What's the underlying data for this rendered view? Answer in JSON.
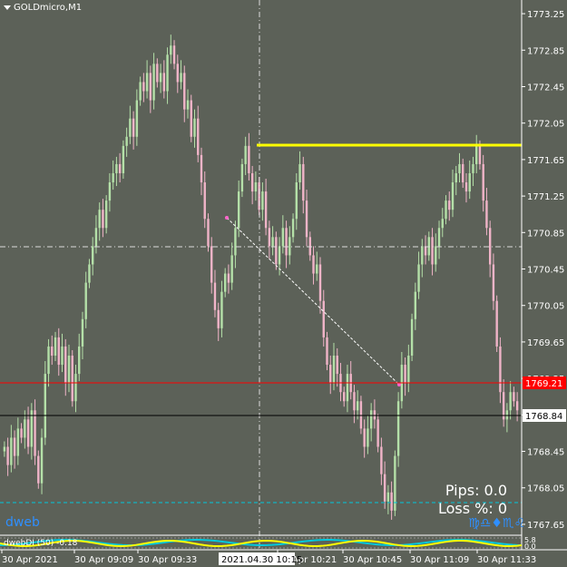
{
  "chart": {
    "symbol_label": "GOLDmicro,M1",
    "brand": "dweb",
    "pips_text": "Pips: 0.0",
    "loss_text": "Loss %: 0",
    "zodiac_text": "♍♎♦♏♌",
    "indicator_label": "dwebDI (50) -0.18",
    "price_labels": [
      "1773.25",
      "1772.85",
      "1772.45",
      "1772.05",
      "1771.65",
      "1771.25",
      "1770.85",
      "1770.45",
      "1770.05",
      "1769.65",
      "1769.25",
      "1768.85",
      "1768.45",
      "1768.05",
      "1767.65"
    ],
    "time_labels": [
      "30 Apr 2021",
      "30 Apr 09:09",
      "30 Apr 09:33",
      "30 Apr 10:21",
      "30 Apr 10:45",
      "30 Apr 11:09",
      "30 Apr 11:33"
    ],
    "cursor_time_label": "2021.04.30 10:15",
    "bid_price_label": "1769.21",
    "price_tag_label": "1768.84",
    "ind_scale_top": "5.8",
    "ind_scale_bottom": "0.0",
    "colors": {
      "background": "#5c6158",
      "bull": "#b4e0a8",
      "bear": "#f0b4c8",
      "resistance": "#ffff00",
      "bid": "#ff0000",
      "accent": "#2e8fff",
      "cyan": "#00c8dc"
    }
  },
  "chart_data": {
    "type": "candlestick",
    "symbol": "GOLDmicro",
    "timeframe": "M1",
    "ylim": [
      1767.55,
      1773.4
    ],
    "closes": [
      1768.5,
      1768.3,
      1768.6,
      1768.4,
      1768.7,
      1768.6,
      1768.8,
      1768.5,
      1768.9,
      1768.4,
      1768.1,
      1768.6,
      1769.3,
      1769.6,
      1769.5,
      1769.7,
      1769.4,
      1769.6,
      1769.2,
      1769.5,
      1769.0,
      1769.3,
      1769.6,
      1769.9,
      1770.3,
      1770.5,
      1770.7,
      1770.9,
      1771.1,
      1770.9,
      1771.2,
      1771.4,
      1771.5,
      1771.6,
      1771.5,
      1771.8,
      1771.9,
      1772.1,
      1771.9,
      1772.3,
      1772.5,
      1772.4,
      1772.6,
      1772.3,
      1772.7,
      1772.5,
      1772.6,
      1772.4,
      1772.8,
      1772.9,
      1772.7,
      1772.5,
      1772.6,
      1772.2,
      1772.3,
      1771.9,
      1772.1,
      1771.7,
      1771.4,
      1771.0,
      1770.7,
      1770.3,
      1770.0,
      1769.8,
      1770.2,
      1770.4,
      1770.3,
      1770.6,
      1770.9,
      1771.3,
      1771.6,
      1771.8,
      1771.5,
      1771.3,
      1771.4,
      1771.1,
      1771.3,
      1770.9,
      1770.7,
      1770.8,
      1770.5,
      1770.7,
      1770.9,
      1770.6,
      1770.8,
      1771.0,
      1771.4,
      1771.6,
      1771.2,
      1770.8,
      1770.6,
      1770.4,
      1770.5,
      1770.1,
      1769.7,
      1769.4,
      1769.2,
      1769.5,
      1769.3,
      1769.1,
      1769.0,
      1769.3,
      1769.1,
      1768.9,
      1769.0,
      1768.7,
      1768.5,
      1768.7,
      1768.9,
      1768.8,
      1768.5,
      1768.2,
      1767.9,
      1768.0,
      1767.8,
      1768.4,
      1769.0,
      1769.4,
      1769.2,
      1769.5,
      1769.9,
      1770.2,
      1770.5,
      1770.7,
      1770.6,
      1770.8,
      1770.5,
      1770.7,
      1770.9,
      1771.0,
      1771.2,
      1771.1,
      1771.4,
      1771.5,
      1771.6,
      1771.4,
      1771.3,
      1771.5,
      1771.6,
      1771.8,
      1771.6,
      1771.2,
      1770.9,
      1770.5,
      1770.1,
      1769.6,
      1769.1,
      1768.8,
      1768.9,
      1769.1,
      1769.0,
      1768.9
    ]
  }
}
